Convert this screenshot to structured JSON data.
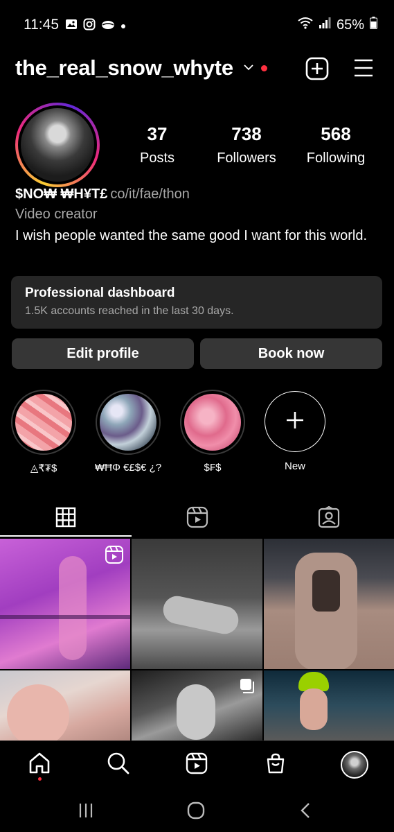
{
  "status_bar": {
    "time": "11:45",
    "battery": "65%",
    "left_icons": [
      "gallery-icon",
      "instagram-icon",
      "cloud-icon",
      "dot-icon"
    ],
    "right_icons": [
      "wifi-icon",
      "signal-icon",
      "battery-icon"
    ]
  },
  "header": {
    "username": "the_real_snow_whyte",
    "icons": [
      "chevron-down-icon",
      "notification-dot",
      "add-icon",
      "menu-icon"
    ]
  },
  "profile": {
    "stats": [
      {
        "value": "37",
        "label": "Posts"
      },
      {
        "value": "738",
        "label": "Followers"
      },
      {
        "value": "568",
        "label": "Following"
      }
    ],
    "display_name": "$NO₩ ₩H¥T£",
    "link": "co/it/fae/thon",
    "category": "Video creator",
    "bio": "I wish people wanted the same good I want for this world."
  },
  "dashboard": {
    "title": "Professional dashboard",
    "subtitle": "1.5K accounts reached in the last 30 days."
  },
  "buttons": {
    "edit_profile": "Edit profile",
    "book_now": "Book now"
  },
  "highlights": [
    {
      "label": "◬₹₮$"
    },
    {
      "label": "₩ĦΦ €£$€ ¿?"
    },
    {
      "label": "$₣$"
    },
    {
      "label": "New"
    }
  ],
  "tabs": [
    "grid-icon",
    "reels-icon",
    "tagged-icon"
  ],
  "bottom_nav": [
    "home-icon",
    "search-icon",
    "reels-icon",
    "shop-icon",
    "profile-avatar"
  ],
  "system_nav": [
    "recents-icon",
    "home-circle-icon",
    "back-icon"
  ],
  "colors": {
    "background": "#000000",
    "card": "#262626",
    "button": "#363636",
    "secondary_text": "#a8a8a8",
    "accent_red": "#ff3040"
  }
}
